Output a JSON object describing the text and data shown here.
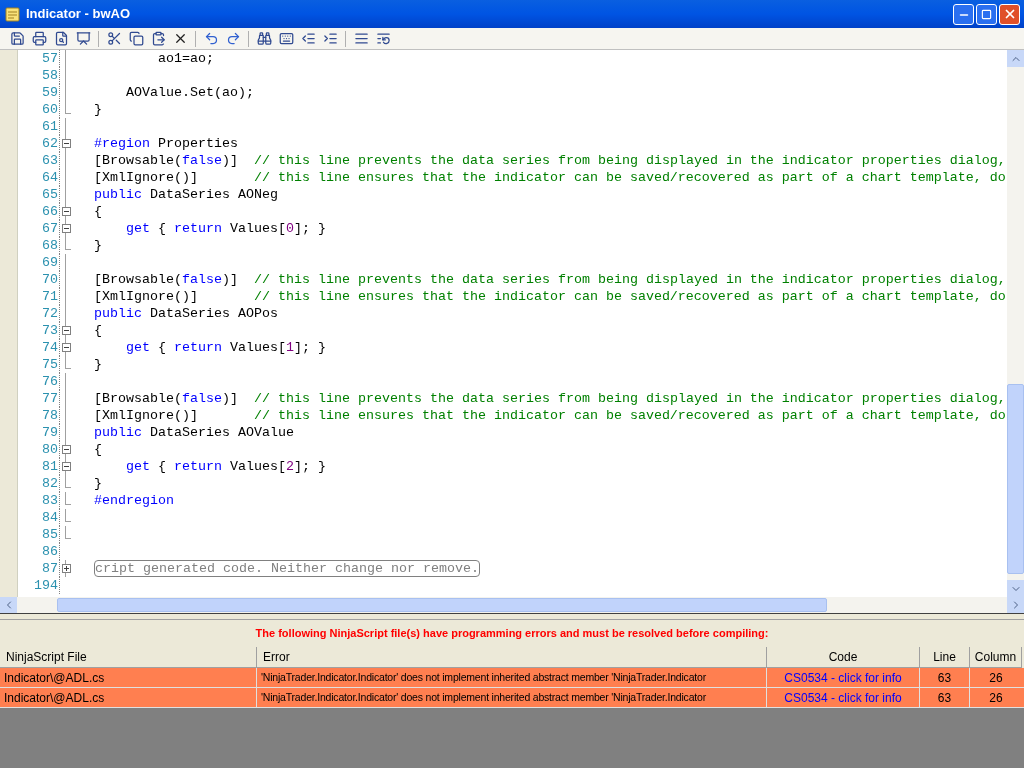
{
  "window": {
    "title": "Indicator - bwAO"
  },
  "editor": {
    "lines": [
      {
        "number": "57",
        "kind": "line",
        "tokens": [
          {
            "kind": "text",
            "text": "        ao1=ao;"
          }
        ]
      },
      {
        "number": "58",
        "kind": "line"
      },
      {
        "number": "59",
        "kind": "line",
        "tokens": [
          {
            "kind": "text",
            "text": "    AOValue.Set(ao);"
          }
        ]
      },
      {
        "number": "60",
        "kind": "end",
        "tokens": [
          {
            "kind": "text",
            "text": "}"
          }
        ]
      },
      {
        "number": "61",
        "kind": "line"
      },
      {
        "number": "62",
        "kind": "open",
        "tokens": [
          {
            "kind": "keyword",
            "text": "#region"
          },
          {
            "kind": "text",
            "text": " Properties"
          }
        ]
      },
      {
        "number": "63",
        "kind": "line",
        "tokens": [
          {
            "kind": "text",
            "text": "[Browsable("
          },
          {
            "kind": "keyword",
            "text": "false"
          },
          {
            "kind": "text",
            "text": ")]  "
          },
          {
            "kind": "comment",
            "text": "// this line prevents the data series from being displayed in the indicator properties dialog,"
          }
        ]
      },
      {
        "number": "64",
        "kind": "line",
        "tokens": [
          {
            "kind": "text",
            "text": "[XmlIgnore()]       "
          },
          {
            "kind": "comment",
            "text": "// this line ensures that the indicator can be saved/recovered as part of a chart template, do"
          }
        ]
      },
      {
        "number": "65",
        "kind": "line",
        "tokens": [
          {
            "kind": "keyword",
            "text": "public"
          },
          {
            "kind": "text",
            "text": " DataSeries AONeg"
          }
        ]
      },
      {
        "number": "66",
        "kind": "open",
        "tokens": [
          {
            "kind": "text",
            "text": "{"
          }
        ]
      },
      {
        "number": "67",
        "kind": "open",
        "tokens": [
          {
            "kind": "keyword",
            "text": "    get"
          },
          {
            "kind": "text",
            "text": " { "
          },
          {
            "kind": "keyword",
            "text": "return"
          },
          {
            "kind": "text",
            "text": " Values["
          },
          {
            "kind": "number",
            "text": "0"
          },
          {
            "kind": "text",
            "text": "]; }"
          }
        ]
      },
      {
        "number": "68",
        "kind": "end",
        "tokens": [
          {
            "kind": "text",
            "text": "}"
          }
        ]
      },
      {
        "number": "69",
        "kind": "line"
      },
      {
        "number": "70",
        "kind": "line",
        "tokens": [
          {
            "kind": "text",
            "text": "[Browsable("
          },
          {
            "kind": "keyword",
            "text": "false"
          },
          {
            "kind": "text",
            "text": ")]  "
          },
          {
            "kind": "comment",
            "text": "// this line prevents the data series from being displayed in the indicator properties dialog,"
          }
        ]
      },
      {
        "number": "71",
        "kind": "line",
        "tokens": [
          {
            "kind": "text",
            "text": "[XmlIgnore()]       "
          },
          {
            "kind": "comment",
            "text": "// this line ensures that the indicator can be saved/recovered as part of a chart template, do"
          }
        ]
      },
      {
        "number": "72",
        "kind": "line",
        "tokens": [
          {
            "kind": "keyword",
            "text": "public"
          },
          {
            "kind": "text",
            "text": " DataSeries AOPos"
          }
        ]
      },
      {
        "number": "73",
        "kind": "open",
        "tokens": [
          {
            "kind": "text",
            "text": "{"
          }
        ]
      },
      {
        "number": "74",
        "kind": "open",
        "tokens": [
          {
            "kind": "keyword",
            "text": "    get"
          },
          {
            "kind": "text",
            "text": " { "
          },
          {
            "kind": "keyword",
            "text": "return"
          },
          {
            "kind": "text",
            "text": " Values["
          },
          {
            "kind": "number",
            "text": "1"
          },
          {
            "kind": "text",
            "text": "]; }"
          }
        ]
      },
      {
        "number": "75",
        "kind": "end",
        "tokens": [
          {
            "kind": "text",
            "text": "}"
          }
        ]
      },
      {
        "number": "76",
        "kind": "line"
      },
      {
        "number": "77",
        "kind": "line",
        "tokens": [
          {
            "kind": "text",
            "text": "[Browsable("
          },
          {
            "kind": "keyword",
            "text": "false"
          },
          {
            "kind": "text",
            "text": ")]  "
          },
          {
            "kind": "comment",
            "text": "// this line prevents the data series from being displayed in the indicator properties dialog,"
          }
        ]
      },
      {
        "number": "78",
        "kind": "line",
        "tokens": [
          {
            "kind": "text",
            "text": "[XmlIgnore()]       "
          },
          {
            "kind": "comment",
            "text": "// this line ensures that the indicator can be saved/recovered as part of a chart template, do"
          }
        ]
      },
      {
        "number": "79",
        "kind": "line",
        "tokens": [
          {
            "kind": "keyword",
            "text": "public"
          },
          {
            "kind": "text",
            "text": " DataSeries AOValue"
          }
        ]
      },
      {
        "number": "80",
        "kind": "open",
        "tokens": [
          {
            "kind": "text",
            "text": "{"
          }
        ]
      },
      {
        "number": "81",
        "kind": "open",
        "tokens": [
          {
            "kind": "keyword",
            "text": "    get"
          },
          {
            "kind": "text",
            "text": " { "
          },
          {
            "kind": "keyword",
            "text": "return"
          },
          {
            "kind": "text",
            "text": " Values["
          },
          {
            "kind": "number",
            "text": "2"
          },
          {
            "kind": "text",
            "text": "]; }"
          }
        ]
      },
      {
        "number": "82",
        "kind": "end",
        "tokens": [
          {
            "kind": "text",
            "text": "}"
          }
        ]
      },
      {
        "number": "83",
        "kind": "end",
        "tokens": [
          {
            "kind": "keyword",
            "text": "#endregion"
          }
        ]
      },
      {
        "number": "84",
        "kind": "end"
      },
      {
        "number": "85",
        "kind": "end"
      },
      {
        "number": "86",
        "kind": "none"
      },
      {
        "number": "87",
        "kind": "closed",
        "tokens": [
          {
            "kind": "collapsed",
            "text": "cript generated code. Neither change nor remove."
          }
        ]
      },
      {
        "number": "194",
        "kind": "none"
      }
    ]
  },
  "errors": {
    "message": "The following NinjaScript file(s) have programming errors and must be resolved before compiling:",
    "columns": [
      "NinjaScript File",
      "Error",
      "Code",
      "Line",
      "Column"
    ],
    "rows": [
      {
        "file": "Indicator\\@ADL.cs",
        "error": "'NinjaTrader.Indicator.Indicator' does not implement inherited abstract member 'NinjaTrader.Indicator",
        "code": "CS0534 - click for info",
        "line": "63",
        "column": "26"
      },
      {
        "file": "Indicator\\@ADL.cs",
        "error": "'NinjaTrader.Indicator.Indicator' does not implement inherited abstract member 'NinjaTrader.Indicator",
        "code": "CS0534 - click for info",
        "line": "63",
        "column": "26"
      }
    ]
  }
}
